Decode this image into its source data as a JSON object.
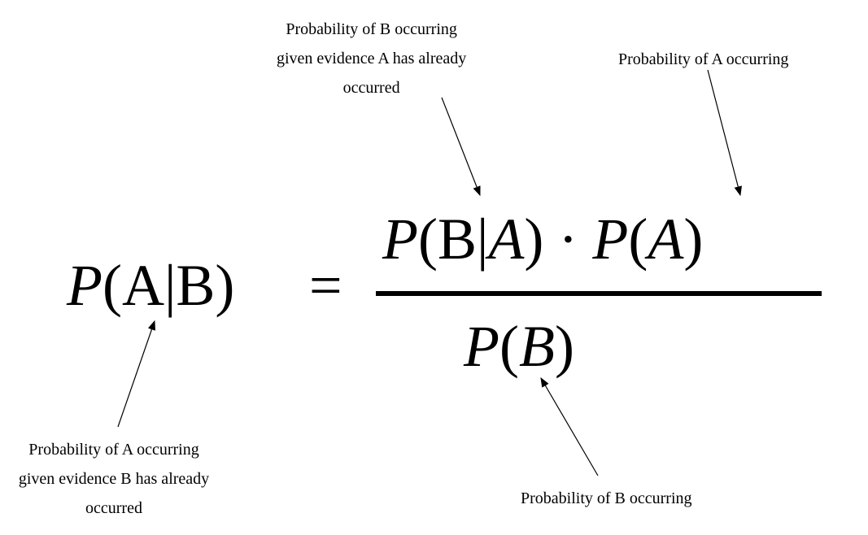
{
  "formula": {
    "lhs": {
      "P": "P",
      "open": "(",
      "A": "A",
      "bar": "|",
      "B": "B",
      "close": ")"
    },
    "equals": "=",
    "numerator": {
      "P1": "P",
      "open1": "(",
      "B": "B",
      "bar": "|",
      "A1": "A",
      "close1": ")",
      "dot": " · ",
      "P2": "P",
      "open2": "(",
      "A2": "A",
      "close2": ")"
    },
    "denominator": {
      "P": "P",
      "open": "(",
      "B": "B",
      "close": ")"
    }
  },
  "annotations": {
    "pba": {
      "line1": "Probability of B occurring",
      "line2": "given evidence A has already",
      "line3": "occurred"
    },
    "pa": "Probability of A occurring",
    "pab": {
      "line1": "Probability of A occurring",
      "line2": "given evidence B has already",
      "line3": "occurred"
    },
    "pb": "Probability of B occurring"
  }
}
